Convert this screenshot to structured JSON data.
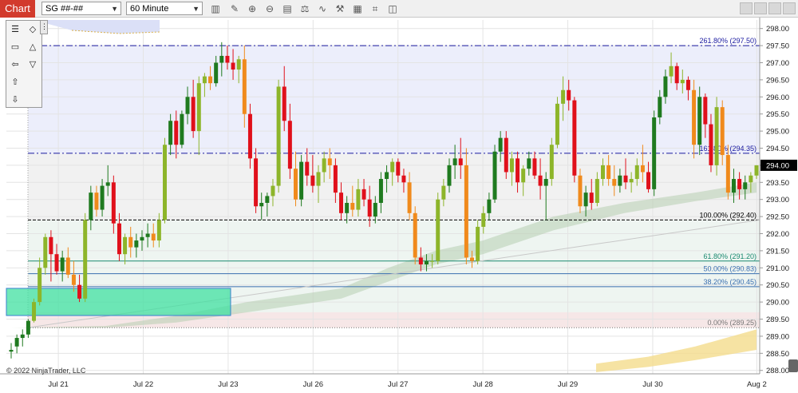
{
  "toolbar": {
    "tab_label": "Chart",
    "instrument": "SG ##-##",
    "interval": "60 Minute",
    "icons": [
      "bars-icon",
      "pencil-icon",
      "zoom-in-icon",
      "zoom-out-icon",
      "properties-icon",
      "strategy-icon",
      "indicator-icon",
      "drawing-icon",
      "data-box-icon",
      "chart-trader-icon",
      "snapshot-icon"
    ]
  },
  "drawing_palette": {
    "icons": [
      "menu-icon",
      "diamond-icon",
      "rectangle-icon",
      "triangle-up-icon",
      "arrow-line-icon",
      "triangle-down-icon",
      "arrow-up-icon",
      "arrow-down-icon"
    ]
  },
  "copyright": "© 2022 NinjaTrader, LLC",
  "colors": {
    "up_dark": "#1f7a1f",
    "up_light": "#8db52a",
    "down_red": "#e0101b",
    "down_orange": "#f08a1c",
    "fib_line": "#1a1aa0",
    "cloud": "#b7cdb0",
    "yellow_cloud": "#f4dc8c",
    "zone_green": "#40e0a0",
    "price_box": "#000000"
  },
  "chart_data": {
    "type": "candlestick",
    "x_labels": [
      "Jul 21",
      "Jul 22",
      "Jul 23",
      "Jul 26",
      "Jul 27",
      "Jul 28",
      "Jul 29",
      "Jul 30",
      "Aug 2"
    ],
    "y_ticks": [
      "288.00",
      "288.50",
      "289.00",
      "289.50",
      "290.00",
      "290.50",
      "291.00",
      "291.50",
      "292.00",
      "292.50",
      "293.00",
      "293.50",
      "294.00",
      "294.50",
      "295.00",
      "295.50",
      "296.00",
      "296.50",
      "297.00",
      "297.50",
      "298.00"
    ],
    "ylim": [
      287.9,
      298.25
    ],
    "last_price": "294.00",
    "fib_levels": [
      {
        "label": "261.80% (297.50)",
        "value": 297.5,
        "style": "dashdot"
      },
      {
        "label": "161.80% (294.35)",
        "value": 294.35,
        "style": "dashdot"
      },
      {
        "label": "100.00% (292.40)",
        "value": 292.4,
        "style": "dashed"
      },
      {
        "label": "61.80% (291.20)",
        "value": 291.2,
        "style": "solid"
      },
      {
        "label": "50.00% (290.83)",
        "value": 290.83,
        "style": "solid"
      },
      {
        "label": "38.20% (290.45)",
        "value": 290.45,
        "style": "solid"
      },
      {
        "label": "0.00% (289.25)",
        "value": 289.25,
        "style": "dotted"
      }
    ],
    "candles": [
      [
        288.55,
        288.8,
        288.35,
        288.6
      ],
      [
        288.7,
        289.05,
        288.5,
        288.95
      ],
      [
        288.95,
        289.2,
        288.7,
        289.05
      ],
      [
        289.05,
        289.5,
        288.95,
        289.45
      ],
      [
        289.45,
        290.1,
        289.4,
        290.0
      ],
      [
        290.0,
        291.3,
        289.9,
        291.0
      ],
      [
        291.0,
        292.0,
        290.8,
        291.9
      ],
      [
        291.9,
        292.1,
        290.6,
        291.4
      ],
      [
        291.4,
        291.7,
        290.8,
        290.9
      ],
      [
        290.9,
        291.5,
        290.6,
        291.3
      ],
      [
        291.3,
        291.6,
        290.7,
        290.8
      ],
      [
        290.8,
        291.2,
        290.3,
        290.5
      ],
      [
        290.5,
        290.8,
        290.0,
        290.1
      ],
      [
        290.1,
        292.6,
        290.0,
        292.4
      ],
      [
        292.4,
        293.4,
        292.1,
        293.2
      ],
      [
        293.2,
        293.4,
        292.5,
        292.7
      ],
      [
        292.7,
        293.6,
        292.5,
        293.4
      ],
      [
        293.4,
        294.0,
        293.1,
        293.5
      ],
      [
        293.5,
        293.7,
        292.0,
        292.3
      ],
      [
        292.3,
        292.6,
        291.2,
        291.4
      ],
      [
        291.4,
        292.0,
        291.1,
        291.9
      ],
      [
        291.9,
        292.2,
        291.3,
        291.6
      ],
      [
        291.6,
        292.0,
        291.3,
        291.8
      ],
      [
        291.8,
        292.1,
        291.5,
        291.9
      ],
      [
        291.9,
        292.3,
        291.6,
        292.0
      ],
      [
        292.0,
        292.3,
        291.6,
        291.8
      ],
      [
        291.8,
        292.6,
        291.6,
        292.4
      ],
      [
        292.4,
        294.8,
        292.3,
        294.6
      ],
      [
        294.6,
        295.5,
        294.3,
        295.3
      ],
      [
        295.3,
        295.6,
        294.2,
        294.6
      ],
      [
        294.6,
        295.6,
        294.5,
        295.5
      ],
      [
        295.5,
        296.3,
        295.2,
        296.0
      ],
      [
        296.0,
        296.5,
        294.8,
        295.0
      ],
      [
        295.0,
        296.6,
        294.3,
        296.4
      ],
      [
        296.4,
        296.7,
        296.0,
        296.6
      ],
      [
        296.6,
        296.9,
        296.2,
        296.4
      ],
      [
        296.4,
        297.2,
        296.3,
        297.0
      ],
      [
        297.0,
        297.6,
        296.6,
        297.2
      ],
      [
        297.2,
        297.5,
        296.8,
        297.0
      ],
      [
        297.0,
        297.4,
        296.5,
        296.8
      ],
      [
        296.8,
        297.2,
        296.4,
        297.1
      ],
      [
        297.1,
        297.5,
        295.1,
        295.5
      ],
      [
        295.5,
        295.8,
        293.9,
        294.2
      ],
      [
        294.2,
        294.5,
        292.6,
        292.8
      ],
      [
        292.8,
        293.2,
        292.4,
        292.9
      ],
      [
        292.9,
        293.2,
        292.5,
        293.1
      ],
      [
        293.1,
        293.6,
        292.8,
        293.4
      ],
      [
        293.4,
        296.5,
        293.2,
        296.3
      ],
      [
        296.3,
        296.9,
        295.0,
        295.3
      ],
      [
        295.3,
        295.8,
        293.6,
        293.9
      ],
      [
        293.9,
        294.4,
        292.8,
        293.0
      ],
      [
        293.0,
        294.3,
        292.8,
        294.1
      ],
      [
        294.1,
        294.5,
        293.4,
        293.7
      ],
      [
        293.7,
        294.3,
        293.2,
        293.4
      ],
      [
        293.4,
        294.0,
        292.9,
        293.8
      ],
      [
        293.8,
        294.4,
        293.5,
        294.2
      ],
      [
        294.2,
        294.5,
        293.6,
        294.0
      ],
      [
        294.0,
        294.2,
        292.9,
        293.2
      ],
      [
        293.2,
        293.5,
        292.4,
        292.6
      ],
      [
        292.6,
        293.1,
        292.3,
        292.9
      ],
      [
        292.9,
        293.4,
        292.5,
        292.7
      ],
      [
        292.7,
        293.6,
        292.5,
        293.3
      ],
      [
        293.3,
        293.6,
        292.8,
        293.0
      ],
      [
        293.0,
        293.4,
        292.2,
        292.5
      ],
      [
        292.5,
        293.1,
        292.3,
        292.9
      ],
      [
        292.9,
        293.8,
        292.6,
        293.6
      ],
      [
        293.6,
        294.0,
        293.2,
        293.8
      ],
      [
        293.8,
        294.2,
        293.4,
        294.1
      ],
      [
        294.1,
        294.2,
        293.5,
        293.7
      ],
      [
        293.7,
        293.9,
        293.2,
        293.5
      ],
      [
        293.5,
        293.8,
        292.4,
        292.6
      ],
      [
        292.6,
        292.8,
        291.1,
        291.3
      ],
      [
        291.3,
        291.6,
        290.9,
        291.1
      ],
      [
        291.1,
        291.4,
        290.9,
        291.2
      ],
      [
        291.2,
        291.4,
        291.0,
        291.2
      ],
      [
        291.2,
        293.2,
        291.1,
        293.0
      ],
      [
        293.0,
        293.6,
        292.8,
        293.4
      ],
      [
        293.4,
        294.2,
        293.2,
        294.0
      ],
      [
        294.0,
        294.6,
        293.6,
        294.2
      ],
      [
        294.2,
        294.8,
        293.6,
        294.0
      ],
      [
        294.0,
        294.5,
        291.1,
        291.3
      ],
      [
        291.3,
        291.5,
        291.0,
        291.2
      ],
      [
        291.2,
        292.4,
        291.1,
        292.2
      ],
      [
        292.2,
        292.8,
        292.0,
        292.6
      ],
      [
        292.6,
        293.2,
        292.4,
        293.0
      ],
      [
        293.0,
        294.6,
        292.9,
        294.4
      ],
      [
        294.4,
        295.0,
        294.1,
        294.8
      ],
      [
        294.8,
        295.0,
        293.6,
        293.8
      ],
      [
        293.8,
        294.4,
        293.4,
        294.2
      ],
      [
        294.2,
        294.4,
        293.2,
        293.5
      ],
      [
        293.5,
        294.0,
        293.1,
        293.9
      ],
      [
        293.9,
        294.4,
        293.7,
        294.2
      ],
      [
        294.2,
        294.4,
        293.6,
        293.7
      ],
      [
        293.7,
        294.2,
        293.0,
        293.4
      ],
      [
        293.4,
        293.8,
        292.4,
        293.6
      ],
      [
        293.6,
        294.8,
        293.4,
        294.6
      ],
      [
        294.6,
        296.0,
        294.5,
        295.8
      ],
      [
        295.8,
        296.6,
        295.3,
        296.2
      ],
      [
        296.2,
        296.5,
        295.6,
        295.9
      ],
      [
        295.9,
        296.0,
        293.5,
        293.7
      ],
      [
        293.7,
        293.9,
        292.6,
        292.8
      ],
      [
        292.8,
        293.4,
        292.5,
        293.2
      ],
      [
        293.2,
        293.6,
        292.7,
        292.9
      ],
      [
        292.9,
        293.8,
        292.8,
        293.6
      ],
      [
        293.6,
        294.2,
        293.4,
        294.0
      ],
      [
        294.0,
        294.3,
        293.4,
        293.6
      ],
      [
        293.6,
        294.0,
        293.1,
        293.4
      ],
      [
        293.4,
        293.9,
        293.2,
        293.7
      ],
      [
        293.7,
        294.2,
        293.3,
        293.5
      ],
      [
        293.5,
        293.8,
        293.2,
        293.6
      ],
      [
        293.6,
        294.2,
        293.4,
        294.0
      ],
      [
        294.0,
        294.6,
        293.5,
        293.8
      ],
      [
        293.8,
        294.1,
        293.2,
        293.3
      ],
      [
        293.3,
        295.6,
        293.1,
        295.4
      ],
      [
        295.4,
        296.2,
        295.2,
        296.0
      ],
      [
        296.0,
        296.8,
        295.8,
        296.6
      ],
      [
        296.6,
        297.3,
        296.4,
        296.9
      ],
      [
        296.9,
        297.0,
        296.2,
        296.4
      ],
      [
        296.4,
        296.8,
        296.1,
        296.5
      ],
      [
        296.5,
        296.6,
        295.9,
        296.2
      ],
      [
        296.2,
        296.5,
        294.2,
        294.6
      ],
      [
        294.6,
        296.3,
        294.3,
        296.0
      ],
      [
        296.0,
        296.1,
        294.8,
        295.2
      ],
      [
        295.2,
        295.5,
        293.8,
        294.0
      ],
      [
        294.0,
        296.0,
        293.7,
        295.7
      ],
      [
        295.7,
        295.9,
        294.0,
        294.3
      ],
      [
        294.3,
        294.6,
        293.0,
        293.2
      ],
      [
        293.2,
        293.9,
        292.9,
        293.6
      ],
      [
        293.6,
        293.8,
        293.0,
        293.3
      ],
      [
        293.3,
        293.7,
        293.0,
        293.5
      ],
      [
        293.5,
        293.8,
        293.2,
        293.7
      ],
      [
        293.7,
        294.0,
        293.6,
        294.0
      ]
    ],
    "ichimoku_cloud": {
      "upper": [
        [
          0,
          289.25
        ],
        [
          40,
          289.3
        ],
        [
          70,
          289.6
        ],
        [
          100,
          290.0
        ],
        [
          120,
          290.2
        ],
        [
          140,
          290.4
        ],
        [
          160,
          291.0
        ],
        [
          180,
          291.5
        ],
        [
          200,
          291.8
        ],
        [
          230,
          292.5
        ],
        [
          260,
          292.9
        ],
        [
          290,
          293.2
        ],
        [
          316,
          293.5
        ]
      ],
      "lower": [
        [
          0,
          289.25
        ],
        [
          40,
          289.25
        ],
        [
          70,
          289.4
        ],
        [
          100,
          289.7
        ],
        [
          120,
          289.9
        ],
        [
          140,
          290.1
        ],
        [
          160,
          290.6
        ],
        [
          180,
          291.1
        ],
        [
          200,
          291.4
        ],
        [
          230,
          292.1
        ],
        [
          260,
          292.6
        ],
        [
          290,
          292.95
        ],
        [
          316,
          293.2
        ]
      ]
    },
    "yellow_cloud": {
      "upper": [
        [
          248,
          288.2
        ],
        [
          270,
          288.4
        ],
        [
          290,
          288.7
        ],
        [
          316,
          289.2
        ]
      ],
      "lower": [
        [
          248,
          287.95
        ],
        [
          270,
          288.1
        ],
        [
          290,
          288.3
        ],
        [
          316,
          288.6
        ]
      ]
    }
  }
}
